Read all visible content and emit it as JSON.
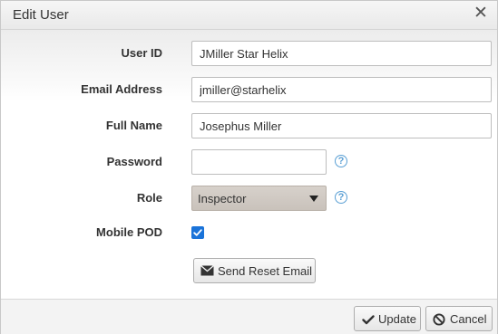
{
  "dialog": {
    "title": "Edit User",
    "close_icon": "close-icon"
  },
  "form": {
    "user_id": {
      "label": "User ID",
      "value": "JMiller Star Helix"
    },
    "email": {
      "label": "Email Address",
      "value": "jmiller@starhelix"
    },
    "full_name": {
      "label": "Full Name",
      "value": "Josephus Miller"
    },
    "password": {
      "label": "Password",
      "value": "",
      "help_icon": "question-circle-icon"
    },
    "role": {
      "label": "Role",
      "value": "Inspector",
      "help_icon": "question-circle-icon"
    },
    "mobile_pod": {
      "label": "Mobile POD",
      "checked": true
    },
    "reset_button": {
      "label": "Send Reset Email",
      "icon": "envelope-icon"
    }
  },
  "footer": {
    "update_label": "Update",
    "update_icon": "checkmark-icon",
    "cancel_label": "Cancel",
    "cancel_icon": "ban-icon"
  },
  "colors": {
    "accent": "#1a73d9",
    "help": "#5a9fd4",
    "select_bg": "#d0c9c2"
  }
}
